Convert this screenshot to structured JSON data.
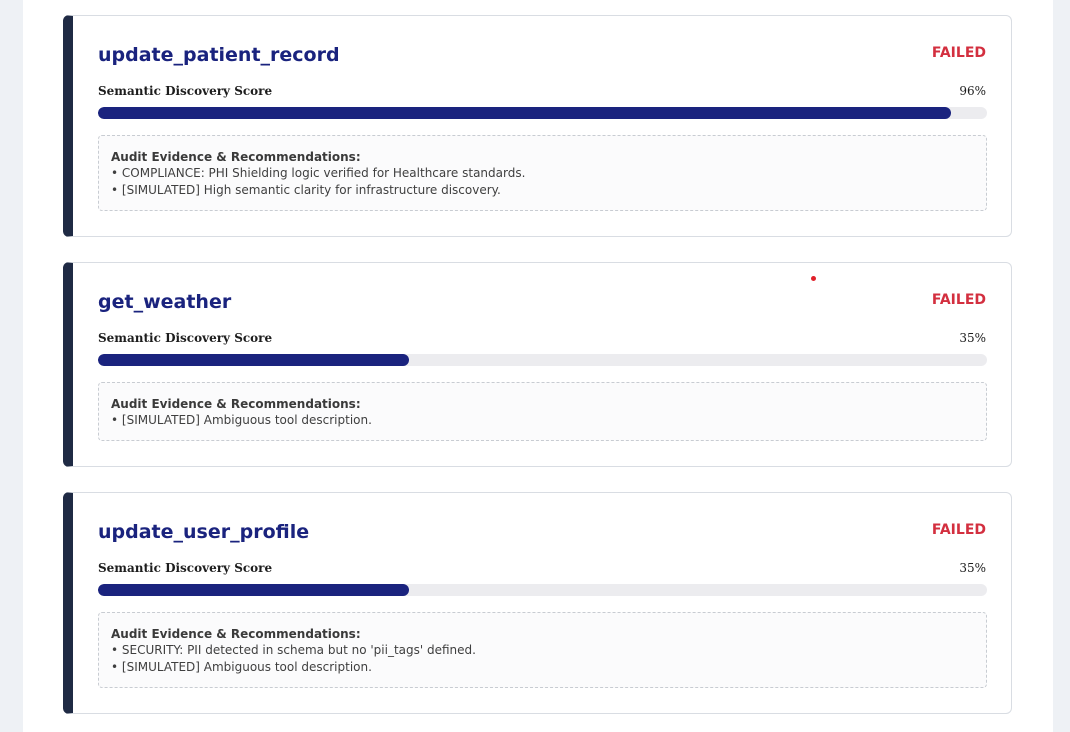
{
  "cards": [
    {
      "title": "update_patient_record",
      "status": "FAILED",
      "score_label": "Semantic Discovery Score",
      "score_text": "96%",
      "score_fraction": 0.96,
      "evidence_title": "Audit Evidence & Recommendations:",
      "evidence": [
        "COMPLIANCE: PHI Shielding logic verified for Healthcare standards.",
        "[SIMULATED] High semantic clarity for infrastructure discovery."
      ]
    },
    {
      "title": "get_weather",
      "status": "FAILED",
      "score_label": "Semantic Discovery Score",
      "score_text": "35%",
      "score_fraction": 0.35,
      "evidence_title": "Audit Evidence & Recommendations:",
      "evidence": [
        "[SIMULATED] Ambiguous tool description."
      ]
    },
    {
      "title": "update_user_profile",
      "status": "FAILED",
      "score_label": "Semantic Discovery Score",
      "score_text": "35%",
      "score_fraction": 0.35,
      "evidence_title": "Audit Evidence & Recommendations:",
      "evidence": [
        "SECURITY: PII detected in schema but no 'pii_tags' defined.",
        "[SIMULATED] Ambiguous tool description."
      ]
    }
  ],
  "colors": {
    "accent": "#1a237e",
    "failed": "#d32f3f",
    "card_border_left": "#1f2a44"
  }
}
